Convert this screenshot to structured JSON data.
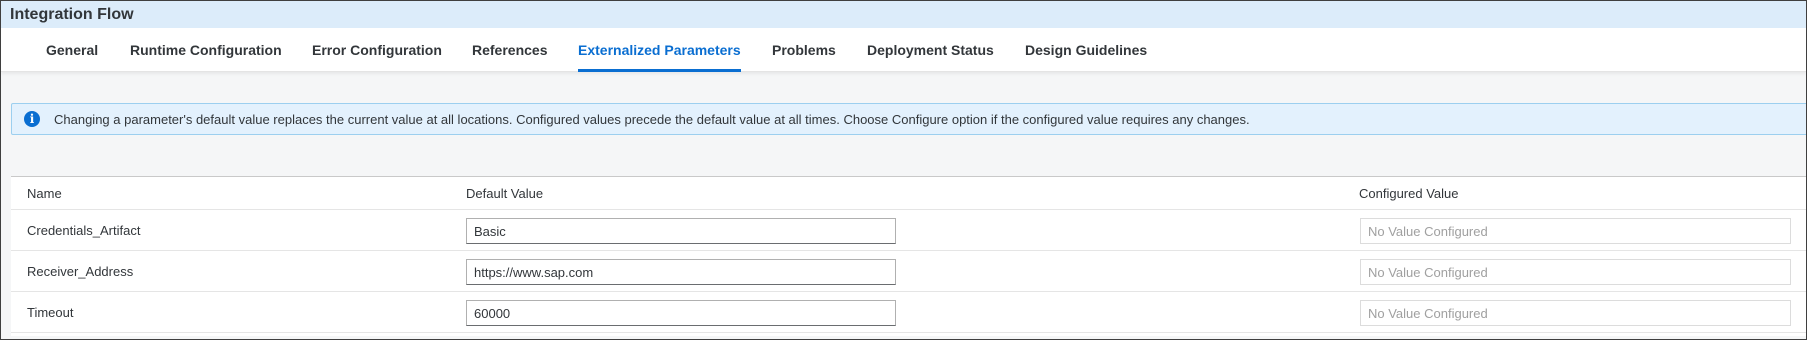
{
  "header": {
    "title": "Integration Flow"
  },
  "tabs": [
    {
      "label": "General",
      "active": false
    },
    {
      "label": "Runtime Configuration",
      "active": false
    },
    {
      "label": "Error Configuration",
      "active": false
    },
    {
      "label": "References",
      "active": false
    },
    {
      "label": "Externalized Parameters",
      "active": true
    },
    {
      "label": "Problems",
      "active": false
    },
    {
      "label": "Deployment Status",
      "active": false
    },
    {
      "label": "Design Guidelines",
      "active": false
    }
  ],
  "info": {
    "icon": "info-icon",
    "message": "Changing a parameter's default value replaces the current value at all locations. Configured values precede the default value at all times. Choose Configure option if the configured value requires any changes."
  },
  "table": {
    "columns": [
      "Name",
      "Default Value",
      "Configured Value"
    ],
    "rows": [
      {
        "name": "Credentials_Artifact",
        "default_value": "Basic",
        "configured_placeholder": "No Value Configured"
      },
      {
        "name": "Receiver_Address",
        "default_value": "https://www.sap.com",
        "configured_placeholder": "No Value Configured"
      },
      {
        "name": "Timeout",
        "default_value": "60000",
        "configured_placeholder": "No Value Configured"
      }
    ]
  },
  "colors": {
    "accent": "#0a6ed1",
    "title_bar": "#dcecfa",
    "info_bg": "#e3f1fd"
  }
}
